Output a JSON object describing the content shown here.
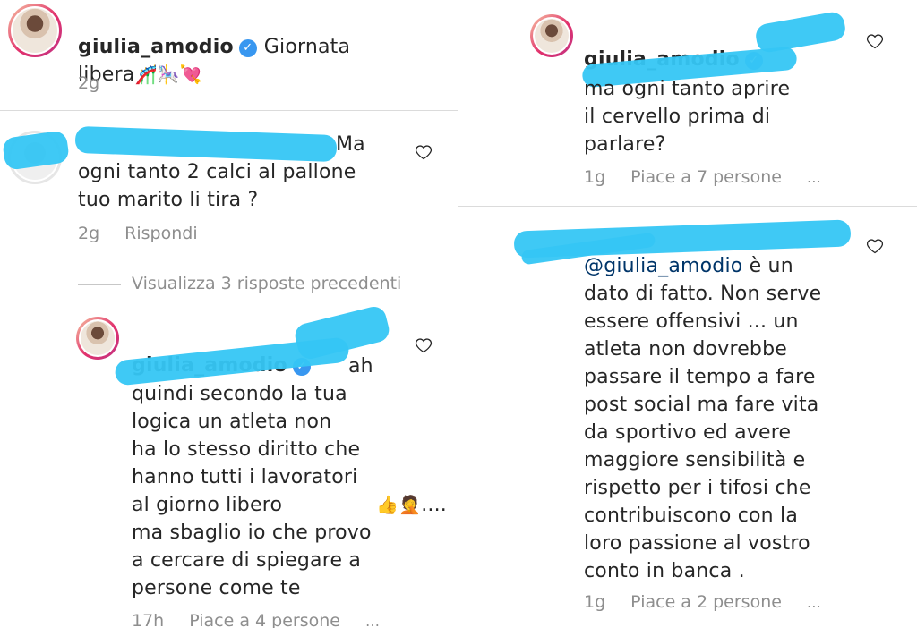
{
  "post": {
    "username": "giulia_amodio",
    "caption": "Giornata\nlibera",
    "caption_emojis": "🎢🎠💘",
    "time": "2g"
  },
  "comment1": {
    "text": "Ma\nogni tanto 2 calci al pallone\ntuo marito li tira ?",
    "time": "2g",
    "reply": "Rispondi"
  },
  "view_replies": "Visualizza 3 risposte precedenti",
  "reply1": {
    "username": "giulia_amodio",
    "text": "ah\nquindi secondo la tua\nlogica un atleta non\nha lo stesso diritto che\nhanno tutti i lavoratori\nal giorno libero",
    "emojis": "👍🤦",
    "ellipsis": "....",
    "text2": "ma sbaglio io che provo\na cercare di spiegare a\npersone come te",
    "time": "17h",
    "likes": "Piace a 4 persone"
  },
  "reply2": {
    "username": "giulia_amodio",
    "text": "ma ogni tanto aprire\nil cervello prima di\nparlare?",
    "time": "1g",
    "likes": "Piace a 7 persone"
  },
  "comment2": {
    "mention": "@giulia_amodio",
    "text_after_mention": " è un",
    "text": "dato di fatto. Non serve\nessere offensivi ... un\natleta non dovrebbe\npassare il tempo a fare\npost social ma fare vita\nda sportivo ed avere\nmaggiore sensibilità e\nrispetto per i  tifosi che\ncontribuiscono con la\nloro passione al vostro\nconto in banca .",
    "time": "1g",
    "likes": "Piace a 2 persone"
  },
  "icons": {
    "verified": "verified-badge-icon",
    "heart": "heart-outline-icon",
    "more": "more-dots-icon"
  },
  "colors": {
    "redaction": "#35c6f4",
    "verified": "#3897f0",
    "secondary_text": "#8e8e8e"
  }
}
